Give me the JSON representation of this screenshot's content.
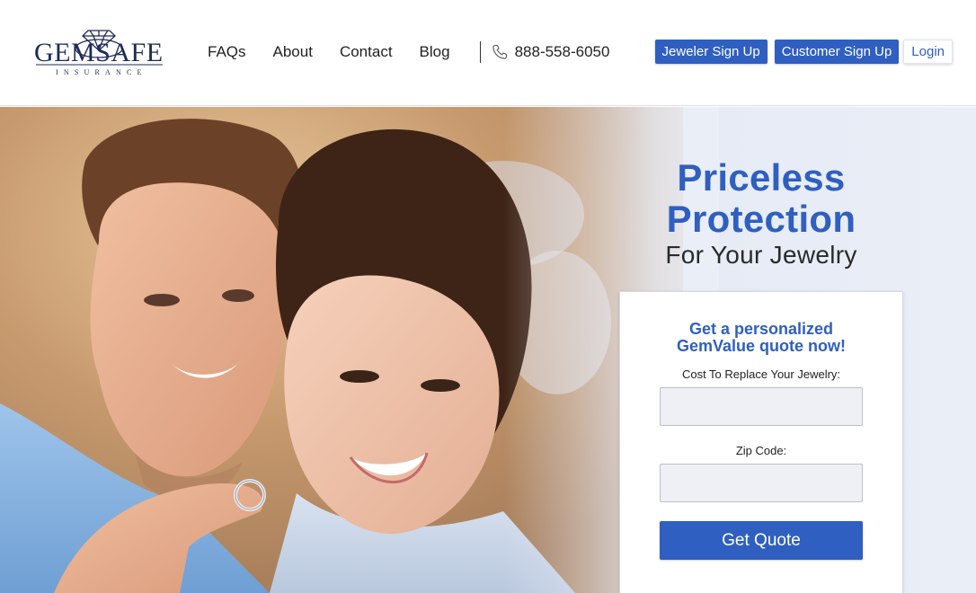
{
  "brand": {
    "logo_text": "GEMSAFE",
    "logo_subtext": "INSURANCE"
  },
  "nav": {
    "items": [
      {
        "label": "FAQs"
      },
      {
        "label": "About"
      },
      {
        "label": "Contact"
      },
      {
        "label": "Blog"
      }
    ],
    "phone": "888-558-6050",
    "phone_icon": "phone-icon"
  },
  "header_buttons": {
    "jeweler_signup": "Jeweler Sign Up",
    "customer_signup": "Customer Sign Up",
    "login": "Login"
  },
  "hero": {
    "headline_1": "Priceless",
    "headline_2": "Protection",
    "subheadline": "For Your Jewelry"
  },
  "quote_form": {
    "title_line1": "Get a personalized",
    "title_line2": "GemValue quote now!",
    "cost_label": "Cost To Replace Your Jewelry:",
    "cost_value": "",
    "zip_label": "Zip Code:",
    "zip_value": "",
    "submit_label": "Get Quote"
  },
  "colors": {
    "brand_blue": "#2f5fc0",
    "logo_navy": "#1c2b57"
  }
}
